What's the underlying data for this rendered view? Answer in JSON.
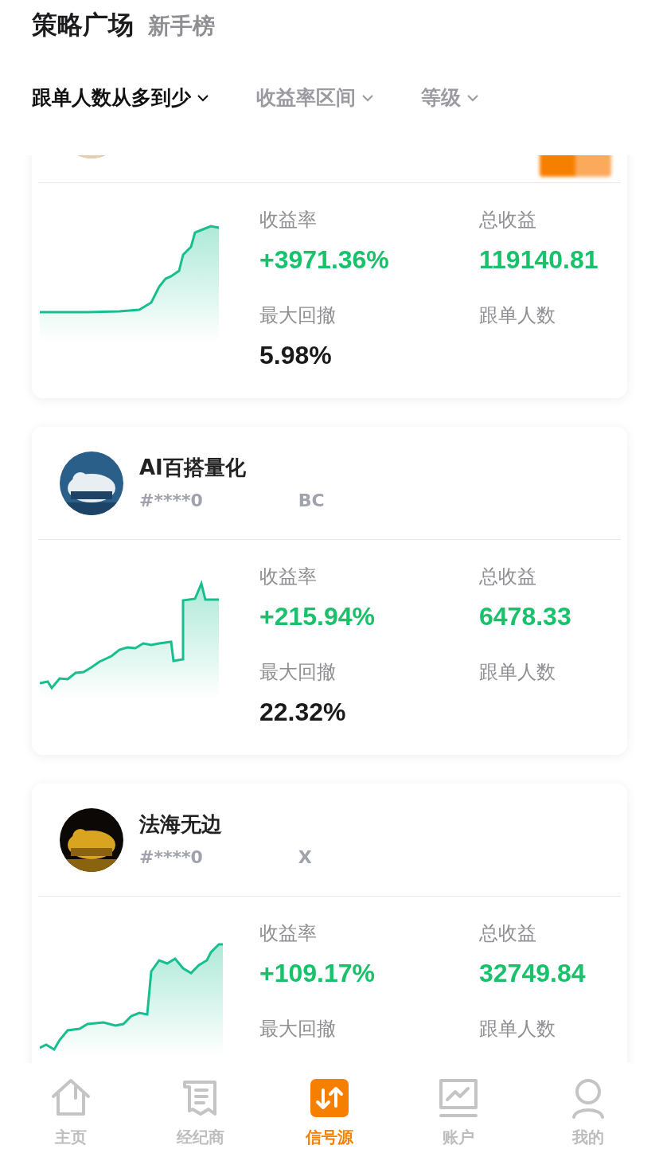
{
  "header": {
    "title": "策略广场",
    "subtitle": "新手榜"
  },
  "filters": [
    {
      "label": "跟单人数从多到少",
      "selected": true
    },
    {
      "label": "收益率区间",
      "selected": false
    },
    {
      "label": "等级",
      "selected": false
    }
  ],
  "cards": [
    {
      "follow_button": true,
      "stats": [
        {
          "label": "收益率",
          "value": "+3971.36%",
          "color": "#18c16a"
        },
        {
          "label": "总收益",
          "value": "119140.81",
          "color": "#18c16a"
        },
        {
          "label": "最大回撤",
          "value": "5.98%",
          "color": "#1a1a1a"
        },
        {
          "label": "跟单人数"
        }
      ]
    },
    {
      "name": "AI百搭量化",
      "id_parts": [
        "#****0",
        "BC"
      ],
      "follow_button": false,
      "stats": [
        {
          "label": "收益率",
          "value": "+215.94%",
          "color": "#18c16a"
        },
        {
          "label": "总收益",
          "value": "6478.33",
          "color": "#18c16a"
        },
        {
          "label": "最大回撤",
          "value": "22.32%",
          "color": "#1a1a1a"
        },
        {
          "label": "跟单人数"
        }
      ]
    },
    {
      "name": "法海无边",
      "id_parts": [
        "#****0",
        "X"
      ],
      "follow_button": false,
      "stats": [
        {
          "label": "收益率",
          "value": "+109.17%",
          "color": "#18c16a"
        },
        {
          "label": "总收益",
          "value": "32749.84",
          "color": "#18c16a"
        },
        {
          "label": "最大回撤"
        },
        {
          "label": "跟单人数"
        }
      ]
    }
  ],
  "nav": [
    {
      "label": "主页",
      "selected": false
    },
    {
      "label": "经纪商",
      "selected": false
    },
    {
      "label": "信号源",
      "selected": true
    },
    {
      "label": "账户",
      "selected": false
    },
    {
      "label": "我的",
      "selected": false
    }
  ]
}
